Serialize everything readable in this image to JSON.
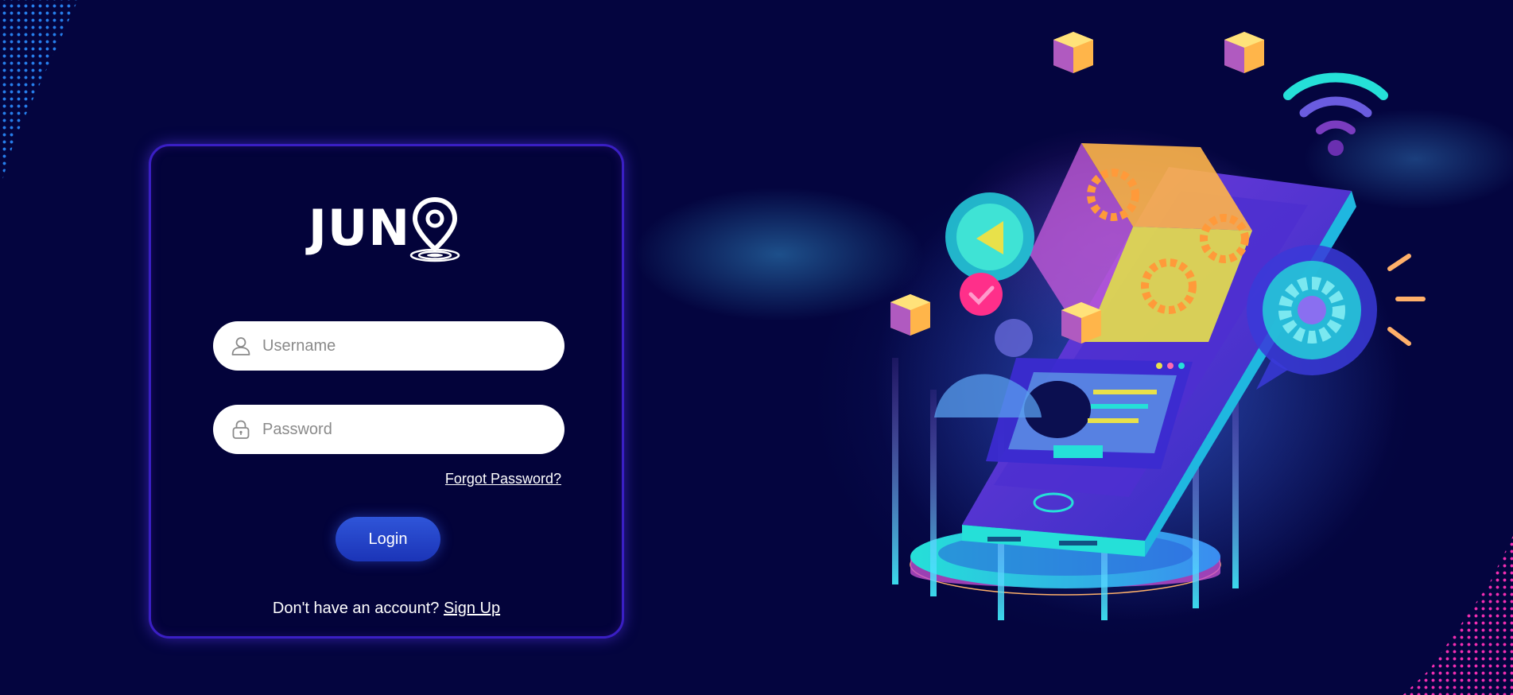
{
  "brand": {
    "logo_text": "JUN"
  },
  "login_form": {
    "username_placeholder": "Username",
    "password_placeholder": "Password",
    "forgot_password_label": "Forgot Password?",
    "login_button_label": "Login",
    "signup_prompt": "Don't have an account?",
    "signup_link_label": "Sign Up"
  },
  "icons": {
    "username": "user-icon",
    "password": "lock-icon",
    "logo": "location-pin-icon"
  },
  "colors": {
    "background": "#04053f",
    "card_background": "#03033a",
    "card_border": "#3a1fc4",
    "button": "#2448c8",
    "input_background": "#ffffff",
    "accent_cyan": "#25e0d8",
    "accent_pink": "#ff2fb8"
  }
}
